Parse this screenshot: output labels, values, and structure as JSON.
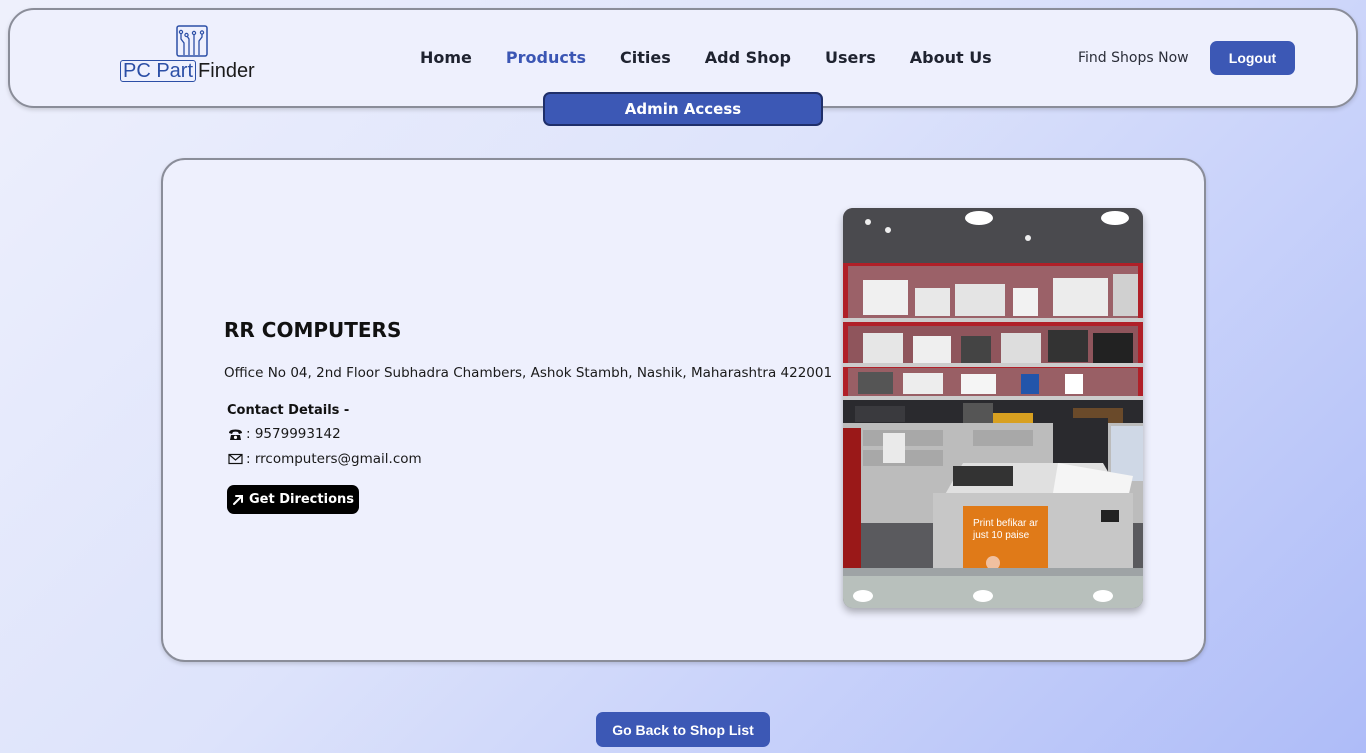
{
  "brand": {
    "part1": "PC Part",
    "part2": "Finder"
  },
  "nav": {
    "items": [
      {
        "label": "Home"
      },
      {
        "label": "Products"
      },
      {
        "label": "Cities"
      },
      {
        "label": "Add Shop"
      },
      {
        "label": "Users"
      },
      {
        "label": "About Us"
      }
    ],
    "active": "Products",
    "find_shops": "Find Shops Now",
    "logout": "Logout"
  },
  "admin_badge": "Admin Access",
  "shop": {
    "name": "RR COMPUTERS",
    "address": "Office No 04, 2nd Floor Subhadra Chambers, Ashok Stambh, Nashik, Maharashtra 422001",
    "contact_title": "Contact Details -",
    "phone": ": 9579993142",
    "email": ": rrcomputers@gmail.com",
    "directions_label": "Get Directions",
    "photo_icon": "shop-interior-photo",
    "photo_text": {
      "line1": "Print befikar ar",
      "line2": "just 10 paise"
    }
  },
  "back_button": "Go Back to Shop List",
  "colors": {
    "accent": "#3c58b5",
    "nav_active": "#3b56b4",
    "card_bg": "#eef0fd"
  }
}
